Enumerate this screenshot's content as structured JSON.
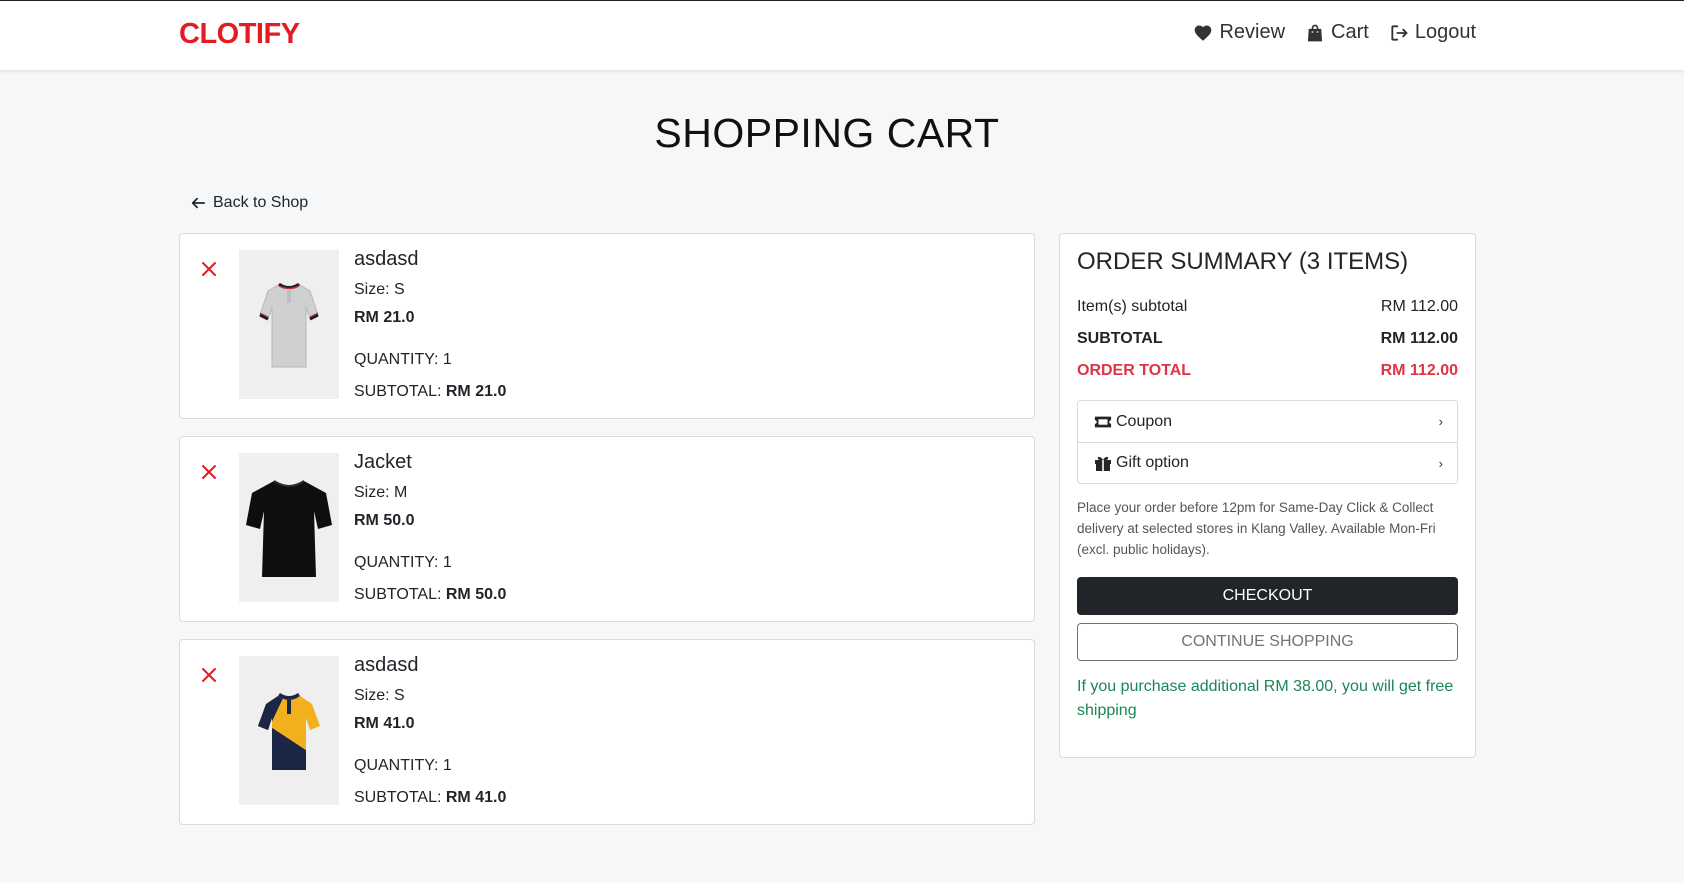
{
  "brand": "CLOTIFY",
  "nav": {
    "review": "Review",
    "cart": "Cart",
    "logout": "Logout"
  },
  "page_title": "SHOPPING CART",
  "back_link": "Back to Shop",
  "cart_items": [
    {
      "name": "asdasd",
      "size": "Size: S",
      "price": "RM 21.0",
      "quantity": "QUANTITY: 1",
      "subtotal_label": "SUBTOTAL: ",
      "subtotal": "RM 21.0"
    },
    {
      "name": "Jacket",
      "size": "Size: M",
      "price": "RM 50.0",
      "quantity": "QUANTITY: 1",
      "subtotal_label": "SUBTOTAL: ",
      "subtotal": "RM 50.0"
    },
    {
      "name": "asdasd",
      "size": "Size: S",
      "price": "RM 41.0",
      "quantity": "QUANTITY: 1",
      "subtotal_label": "SUBTOTAL: ",
      "subtotal": "RM 41.0"
    }
  ],
  "summary": {
    "title": "ORDER SUMMARY (3 ITEMS)",
    "items_subtotal_label": "Item(s) subtotal",
    "items_subtotal_value": "RM 112.00",
    "subtotal_label": "SUBTOTAL",
    "subtotal_value": "RM 112.00",
    "order_total_label": "ORDER TOTAL",
    "order_total_value": "RM 112.00",
    "coupon_label": "Coupon",
    "gift_label": "Gift option",
    "notice": "Place your order before 12pm for Same-Day Click & Collect delivery at selected stores in Klang Valley. Available Mon-Fri (excl. public holidays).",
    "checkout_label": "CHECKOUT",
    "continue_label": "CONTINUE SHOPPING",
    "shipping_note": "If you purchase additional RM 38.00, you will get free shipping"
  },
  "colors": {
    "brand": "#e31b23",
    "order_total": "#dc3545",
    "shipping_note": "#198754",
    "checkout_bg": "#212529"
  },
  "icons": [
    "heart-icon",
    "shopping-bag-icon",
    "logout-icon",
    "arrow-left-icon",
    "close-icon",
    "ticket-icon",
    "gift-icon",
    "chevron-right-icon"
  ]
}
